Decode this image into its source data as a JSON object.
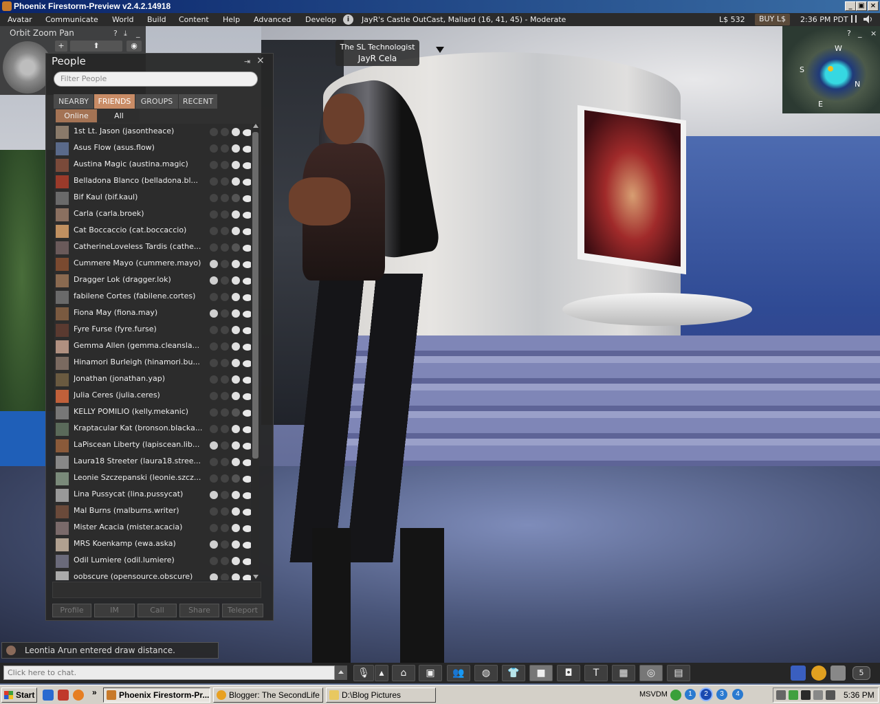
{
  "window": {
    "title": "Phoenix Firestorm-Preview v2.4.2.14918",
    "controls": [
      "_",
      "▣",
      "×"
    ]
  },
  "menubar": {
    "items": [
      "Avatar",
      "Communicate",
      "World",
      "Build",
      "Content",
      "Help",
      "Advanced",
      "Develop"
    ],
    "location": "JayR's Castle OutCast, Mallard (16, 41, 45) - Moderate",
    "balance": "L$ 532",
    "buy_label": "BUY L$",
    "clock": "2:36 PM PDT"
  },
  "camera": {
    "title": "Orbit Zoom Pan",
    "help": "?",
    "minimize": "_",
    "plus": "+"
  },
  "scene": {
    "name_tag_line1": "The SL Technologist",
    "name_tag_line2": "JayR Cela"
  },
  "people": {
    "title": "People",
    "dock": "⇥",
    "close": "×",
    "filter_placeholder": "Filter People",
    "tabs": [
      "NEARBY",
      "FRIENDS",
      "GROUPS",
      "RECENT"
    ],
    "active_tab": "FRIENDS",
    "subtabs": [
      "Online",
      "All"
    ],
    "active_subtab": "Online",
    "friends": [
      {
        "name": "1st Lt. Jason (jasontheace)",
        "map": true,
        "modify": false
      },
      {
        "name": "Asus Flow (asus.flow)",
        "map": true,
        "modify": false
      },
      {
        "name": "Austina Magic (austina.magic)",
        "map": true,
        "modify": false
      },
      {
        "name": "Belladona Blanco (belladona.bl...",
        "map": true,
        "modify": false
      },
      {
        "name": "Bif Kaul (bif.kaul)",
        "map": false,
        "modify": false
      },
      {
        "name": "Carla (carla.broek)",
        "map": true,
        "modify": false
      },
      {
        "name": "Cat Boccaccio (cat.boccaccio)",
        "map": true,
        "modify": false
      },
      {
        "name": "CatherineLoveless Tardis (cathe...",
        "map": false,
        "modify": false
      },
      {
        "name": "Cummere Mayo (cummere.mayo)",
        "map": true,
        "modify": true
      },
      {
        "name": "Dragger Lok (dragger.lok)",
        "map": true,
        "modify": true
      },
      {
        "name": "fabilene Cortes (fabilene.cortes)",
        "map": true,
        "modify": false
      },
      {
        "name": "Fiona May (fiona.may)",
        "map": true,
        "modify": true
      },
      {
        "name": "Fyre Furse (fyre.furse)",
        "map": true,
        "modify": false
      },
      {
        "name": "Gemma Allen (gemma.cleansla...",
        "map": true,
        "modify": false
      },
      {
        "name": "Hinamori Burleigh (hinamori.bu...",
        "map": true,
        "modify": false
      },
      {
        "name": "Jonathan (jonathan.yap)",
        "map": true,
        "modify": false
      },
      {
        "name": "Julia Ceres (julia.ceres)",
        "map": true,
        "modify": false
      },
      {
        "name": "KELLY POMILIO (kelly.mekanic)",
        "map": false,
        "modify": false
      },
      {
        "name": "Kraptacular Kat (bronson.blacka...",
        "map": true,
        "modify": false
      },
      {
        "name": "LaPiscean Liberty (lapiscean.lib...",
        "map": true,
        "modify": true
      },
      {
        "name": "Laura18 Streeter (laura18.stree...",
        "map": true,
        "modify": false
      },
      {
        "name": "Leonie Szczepanski (leonie.szcz...",
        "map": false,
        "modify": false
      },
      {
        "name": "Lina Pussycat (lina.pussycat)",
        "map": true,
        "modify": true
      },
      {
        "name": "Mal Burns (malburns.writer)",
        "map": true,
        "modify": false
      },
      {
        "name": "Mister Acacia (mister.acacia)",
        "map": true,
        "modify": false
      },
      {
        "name": "MRS Koenkamp (ewa.aska)",
        "map": true,
        "modify": true
      },
      {
        "name": "Odil Lumiere (odil.lumiere)",
        "map": true,
        "modify": false
      },
      {
        "name": "oobscure (opensource.obscure)",
        "map": true,
        "modify": true
      }
    ],
    "actions": [
      "Profile",
      "IM",
      "Call",
      "Share",
      "Teleport"
    ]
  },
  "minimap": {
    "help": "?",
    "minimize": "_",
    "labels": {
      "w": "W",
      "s": "S",
      "n": "N",
      "e": "E"
    }
  },
  "notification": {
    "text": "Leontia Arun entered draw distance."
  },
  "bottombar": {
    "chat_placeholder": "Click here to chat.",
    "buttons": [
      "speak",
      "gestures",
      "home",
      "profile",
      "people",
      "search",
      "appearance",
      "camera",
      "snapshot",
      "build",
      "map",
      "minimap",
      "inventory"
    ],
    "notification_count": "5"
  },
  "taskbar": {
    "start": "Start",
    "tasks": [
      {
        "label": "Phoenix Firestorm-Pr...",
        "active": true
      },
      {
        "label": "Blogger: The SecondLife ...",
        "active": false
      },
      {
        "label": "D:\\Blog Pictures",
        "active": false
      }
    ],
    "vdm_label": "MSVDM",
    "desktops": [
      "1",
      "2",
      "3",
      "4"
    ],
    "tray_time": "5:36 PM",
    "quicklaunch_more": "»"
  },
  "colors": {
    "active_tab": "#c98c66",
    "titlebar_start": "#0a246a",
    "titlebar_end": "#3a6ea5"
  }
}
